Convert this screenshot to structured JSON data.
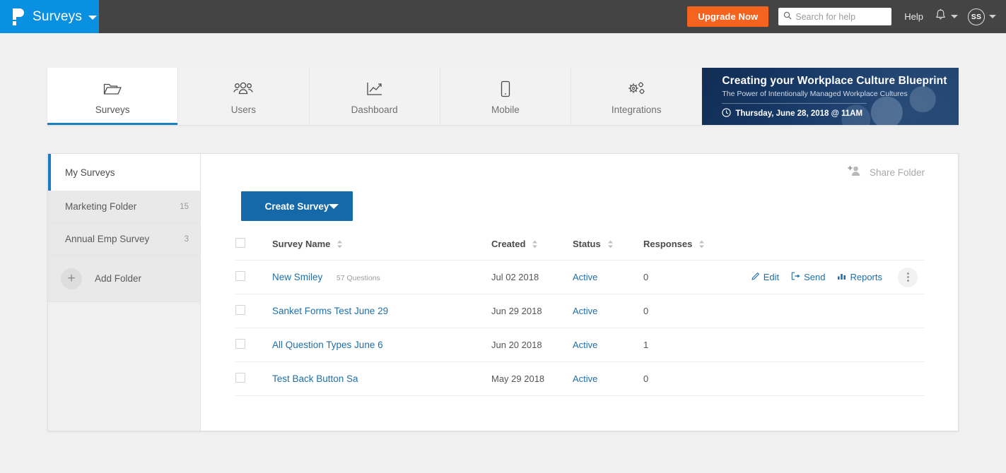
{
  "topbar": {
    "brand_title": "Surveys",
    "logo_name": "proprofs-p-logo",
    "upgrade_label": "Upgrade Now",
    "search_placeholder": "Search for help",
    "search_value": "",
    "help_label": "Help",
    "avatar_initials": "SS",
    "brand_color": "#0a90e0",
    "bar_color": "#444444",
    "upgrade_color": "#f4641e"
  },
  "tabs": [
    {
      "label": "Surveys",
      "icon": "folder-icon",
      "active": true
    },
    {
      "label": "Users",
      "icon": "users-icon",
      "active": false
    },
    {
      "label": "Dashboard",
      "icon": "chart-line-icon",
      "active": false
    },
    {
      "label": "Mobile",
      "icon": "mobile-icon",
      "active": false
    },
    {
      "label": "Integrations",
      "icon": "gears-icon",
      "active": false
    }
  ],
  "banner": {
    "title": "Creating your Workplace Culture Blueprint",
    "subtitle": "The Power of Intentionally Managed Workplace Cultures",
    "date": "Thursday, June 28, 2018 @ 11AM",
    "clock_icon": "clock-icon"
  },
  "sidebar": {
    "folders": [
      {
        "name": "My Surveys",
        "count": "",
        "active": true
      },
      {
        "name": "Marketing Folder",
        "count": "15",
        "active": false
      },
      {
        "name": "Annual Emp Survey",
        "count": "3",
        "active": false
      }
    ],
    "add_folder_label": "Add Folder",
    "add_folder_icon": "plus-icon",
    "accent_color": "#1a7fc1"
  },
  "main": {
    "share_folder_label": "Share Folder",
    "share_folder_icon": "add-person-icon",
    "create_survey_label": "Create Survey",
    "create_button_color": "#1569a8",
    "columns": [
      "Survey Name",
      "Created",
      "Status",
      "Responses"
    ],
    "rows": [
      {
        "name": "New Smiley",
        "questions": "57 Questions",
        "created": "Jul 02 2018",
        "status": "Active",
        "responses": "0",
        "show_actions": true,
        "actions": [
          {
            "label": "Edit",
            "icon": "pencil-icon"
          },
          {
            "label": "Send",
            "icon": "send-arrow-icon"
          },
          {
            "label": "Reports",
            "icon": "bar-chart-icon"
          }
        ]
      },
      {
        "name": "Sanket Forms Test June 29",
        "questions": "",
        "created": "Jun 29 2018",
        "status": "Active",
        "responses": "0",
        "show_actions": false,
        "actions": []
      },
      {
        "name": "All Question Types June 6",
        "questions": "",
        "created": "Jun 20 2018",
        "status": "Active",
        "responses": "1",
        "show_actions": false,
        "actions": []
      },
      {
        "name": "Test Back Button Sa",
        "questions": "",
        "created": "May 29 2018",
        "status": "Active",
        "responses": "0",
        "show_actions": false,
        "actions": []
      }
    ]
  }
}
